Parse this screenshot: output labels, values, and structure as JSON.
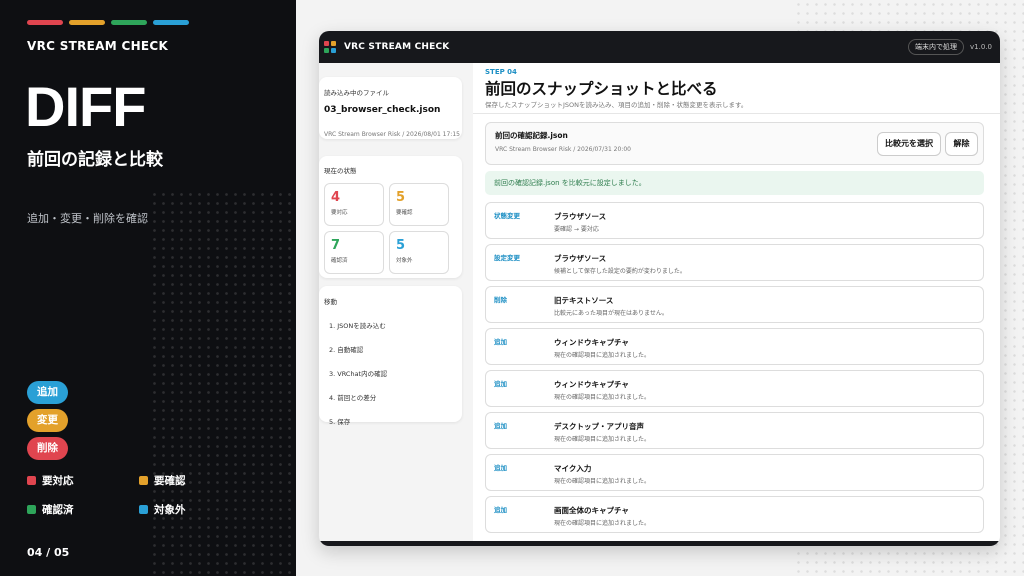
{
  "colors": {
    "red": "#e0454f",
    "orange": "#e3a12b",
    "green": "#2ea55a",
    "blue": "#2aa0d6"
  },
  "left": {
    "brand": "VRC STREAM CHECK",
    "heading": "DIFF",
    "subtitle": "前回の記録と比較",
    "description": "追加・変更・削除を確認",
    "pills": [
      "追加",
      "変更",
      "削除"
    ],
    "legend": [
      {
        "label": "要対応",
        "color": "#e0454f"
      },
      {
        "label": "要確認",
        "color": "#e3a12b"
      },
      {
        "label": "確認済",
        "color": "#2ea55a"
      },
      {
        "label": "対象外",
        "color": "#2aa0d6"
      }
    ],
    "page": "04 / 05"
  },
  "window": {
    "title": "VRC STREAM CHECK",
    "badge": "端末内で処理",
    "version": "v1.0.0"
  },
  "sidebar": {
    "file_label": "読み込み中のファイル",
    "file_name": "03_browser_check.json",
    "file_meta": "VRC Stream Browser Risk / 2026/08/01 17:15",
    "status_label": "現在の状態",
    "stats": [
      {
        "value": "4",
        "label": "要対応",
        "color": "#e0454f"
      },
      {
        "value": "5",
        "label": "要確認",
        "color": "#e3a12b"
      },
      {
        "value": "7",
        "label": "確認済",
        "color": "#2ea55a"
      },
      {
        "value": "5",
        "label": "対象外",
        "color": "#2aa0d6"
      }
    ],
    "nav_label": "移動",
    "nav_items": [
      "1. JSONを読み込む",
      "2. 自動確認",
      "3. VRChat内の確認",
      "4. 前回との差分",
      "5. 保存"
    ]
  },
  "main": {
    "step": "STEP 04",
    "title": "前回のスナップショットと比べる",
    "description": "保存したスナップショットJSONを読み込み、項目の追加・削除・状態変更を表示します。",
    "compare_name": "前回の確認記録.json",
    "compare_meta": "VRC Stream Browser Risk / 2026/07/31 20:00",
    "select_button": "比較元を選択",
    "clear_button": "解除",
    "notice": "前回の確認記録.json を比較元に設定しました。",
    "diffs": [
      {
        "tag": "状態変更",
        "name": "ブラウザソース",
        "desc": "要確認 → 要対応"
      },
      {
        "tag": "設定変更",
        "name": "ブラウザソース",
        "desc": "候補として保存した設定の要約が変わりました。"
      },
      {
        "tag": "削除",
        "name": "旧テキストソース",
        "desc": "比較元にあった項目が現在はありません。"
      },
      {
        "tag": "追加",
        "name": "ウィンドウキャプチャ",
        "desc": "現在の確認項目に追加されました。"
      },
      {
        "tag": "追加",
        "name": "ウィンドウキャプチャ",
        "desc": "現在の確認項目に追加されました。"
      },
      {
        "tag": "追加",
        "name": "デスクトップ・アプリ音声",
        "desc": "現在の確認項目に追加されました。"
      },
      {
        "tag": "追加",
        "name": "マイク入力",
        "desc": "現在の確認項目に追加されました。"
      },
      {
        "tag": "追加",
        "name": "画面全体のキャプチャ",
        "desc": "現在の確認項目に追加されました。"
      }
    ]
  }
}
